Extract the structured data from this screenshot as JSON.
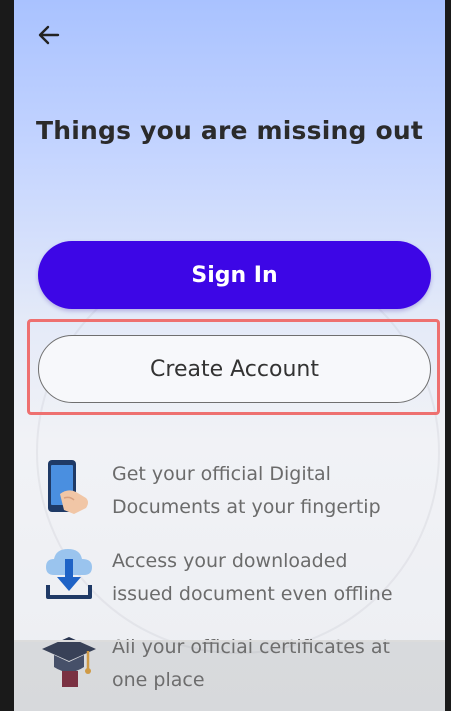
{
  "header": {
    "back_icon": "arrow-left-icon"
  },
  "main": {
    "title": "Things you are missing out",
    "signin_label": "Sign In",
    "create_account_label": "Create Account"
  },
  "features": [
    {
      "icon": "phone-hand-icon",
      "line1": "Get your official Digital",
      "line2": "Documents at your fingertip"
    },
    {
      "icon": "cloud-download-icon",
      "line1": "Access your downloaded",
      "line2": "issued document even offline"
    },
    {
      "icon": "graduation-cap-icon",
      "line1": "All your official certificates at",
      "line2": "one place"
    }
  ],
  "colors": {
    "primary": "#3d06e6",
    "highlight": "#ee7070",
    "title": "#2b2b2b",
    "feature_text": "#6b6b6b"
  }
}
